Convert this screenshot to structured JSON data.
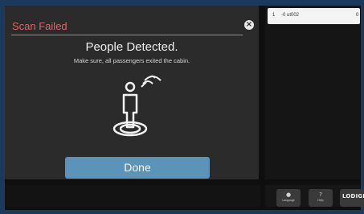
{
  "modal": {
    "title": "Scan Failed",
    "close_icon": "close-icon",
    "heading": "People Detected.",
    "message": "Make sure, all passengers exited the cabin.",
    "illustration_icon": "person-scan-icon",
    "done_label": "Done",
    "title_color": "#d9666c",
    "button_color": "#5b93b9"
  },
  "list": {
    "items": [
      {
        "index": "1",
        "label": "-0 ut002",
        "value": "0"
      }
    ]
  },
  "toolbar": {
    "language": {
      "icon": "language-icon",
      "label": "Language"
    },
    "help": {
      "icon": "help-icon",
      "label": "Help"
    },
    "logo": {
      "text": "LODIGE"
    }
  }
}
